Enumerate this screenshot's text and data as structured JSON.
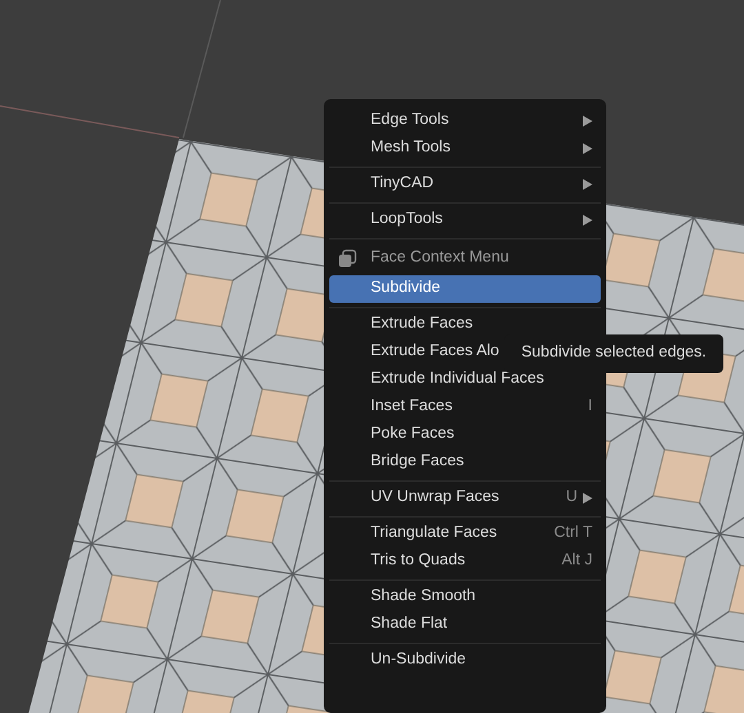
{
  "menu": {
    "sections": [
      {
        "items": [
          {
            "kind": "item",
            "label": "Edge Tools",
            "has_submenu": true,
            "selected": false
          },
          {
            "kind": "item",
            "label": "Mesh Tools",
            "has_submenu": true,
            "selected": false
          }
        ]
      },
      {
        "items": [
          {
            "kind": "item",
            "label": "TinyCAD",
            "has_submenu": true,
            "selected": false
          }
        ]
      },
      {
        "items": [
          {
            "kind": "item",
            "label": "LoopTools",
            "has_submenu": true,
            "selected": false
          }
        ]
      },
      {
        "items": [
          {
            "kind": "header",
            "label": "Face Context Menu"
          },
          {
            "kind": "item",
            "label": "Subdivide",
            "has_submenu": false,
            "selected": true
          }
        ]
      },
      {
        "items": [
          {
            "kind": "item",
            "label": "Extrude Faces",
            "has_submenu": false,
            "selected": false
          },
          {
            "kind": "item",
            "label": "Extrude Faces Alo",
            "has_submenu": false,
            "selected": false
          },
          {
            "kind": "item",
            "label": "Extrude Individual Faces",
            "has_submenu": false,
            "selected": false
          },
          {
            "kind": "item",
            "label": "Inset Faces",
            "shortcut": "I",
            "has_submenu": false,
            "selected": false
          },
          {
            "kind": "item",
            "label": "Poke Faces",
            "has_submenu": false,
            "selected": false
          },
          {
            "kind": "item",
            "label": "Bridge Faces",
            "has_submenu": false,
            "selected": false
          }
        ]
      },
      {
        "items": [
          {
            "kind": "item",
            "label": "UV Unwrap Faces",
            "shortcut": "U",
            "has_submenu": true,
            "selected": false
          }
        ]
      },
      {
        "items": [
          {
            "kind": "item",
            "label": "Triangulate Faces",
            "shortcut": "Ctrl T",
            "has_submenu": false,
            "selected": false
          },
          {
            "kind": "item",
            "label": "Tris to Quads",
            "shortcut": "Alt J",
            "has_submenu": false,
            "selected": false
          }
        ]
      },
      {
        "items": [
          {
            "kind": "item",
            "label": "Shade Smooth",
            "has_submenu": false,
            "selected": false
          },
          {
            "kind": "item",
            "label": "Shade Flat",
            "has_submenu": false,
            "selected": false
          }
        ]
      },
      {
        "items": [
          {
            "kind": "item",
            "label": "Un-Subdivide",
            "has_submenu": false,
            "selected": false
          }
        ]
      }
    ]
  },
  "tooltip": {
    "text": "Subdivide selected edges."
  }
}
